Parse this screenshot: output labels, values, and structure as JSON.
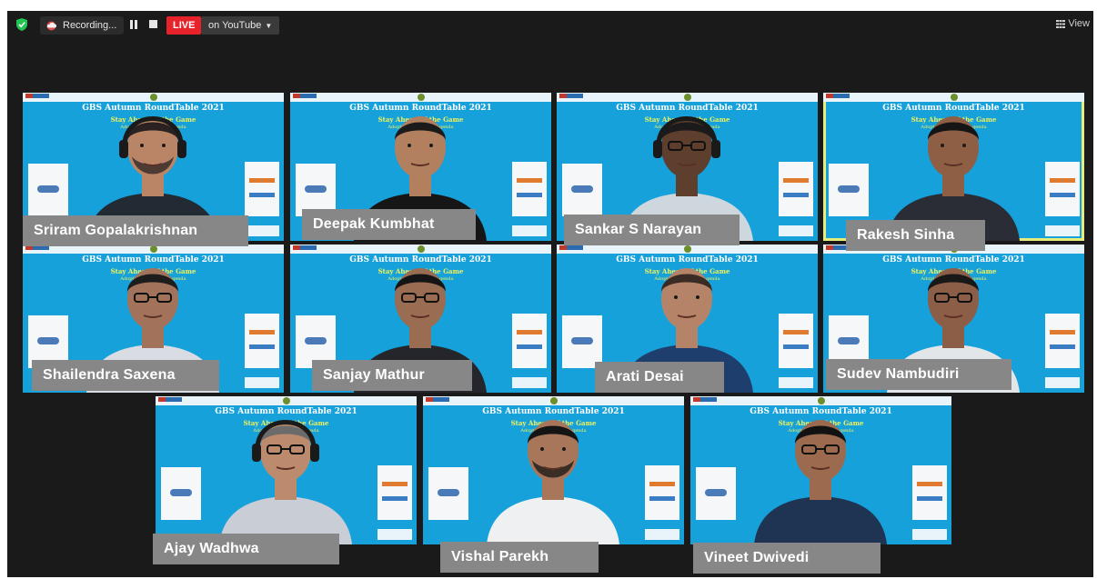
{
  "topbar": {
    "recording_label": "Recording...",
    "live_label": "LIVE",
    "live_destination": "on YouTube",
    "view_label": "View"
  },
  "slide": {
    "title": "GBS Autumn RoundTable 2021",
    "subtitle": "Stay Ahead of the Game",
    "tagline": "Adopting the Digital Agenda"
  },
  "participants": [
    {
      "name": "Sriram Gopalakrishnan",
      "shirt": "#222a33",
      "skin": "#b98566",
      "hair": "#2a2222",
      "headphones": true,
      "glasses": false,
      "beard": true
    },
    {
      "name": "Deepak Kumbhat",
      "shirt": "#161616",
      "skin": "#b3805f",
      "hair": "#1b1b1b",
      "headphones": false,
      "glasses": false,
      "beard": false
    },
    {
      "name": "Sankar S Narayan",
      "shirt": "#cfd7de",
      "skin": "#5e3f2e",
      "hair": "#1b1b1b",
      "headphones": true,
      "glasses": true,
      "beard": false
    },
    {
      "name": "Rakesh Sinha",
      "shirt": "#2a2d36",
      "skin": "#8f5f45",
      "hair": "#151515",
      "headphones": false,
      "glasses": false,
      "beard": false
    },
    {
      "name": "Shailendra Saxena",
      "shirt": "#d9dde3",
      "skin": "#a2735a",
      "hair": "#1d1d1d",
      "headphones": false,
      "glasses": true,
      "beard": false
    },
    {
      "name": "Sanjay Mathur",
      "shirt": "#24262b",
      "skin": "#9a6c52",
      "hair": "#151515",
      "headphones": false,
      "glasses": true,
      "beard": false
    },
    {
      "name": "Arati Desai",
      "shirt": "#1e3f6e",
      "skin": "#b58468",
      "hair": "#3a2c25",
      "headphones": false,
      "glasses": false,
      "beard": false
    },
    {
      "name": "Sudev Nambudiri",
      "shirt": "#e3e6e9",
      "skin": "#8c5e47",
      "hair": "#181818",
      "headphones": false,
      "glasses": true,
      "beard": false
    },
    {
      "name": "Ajay Wadhwa",
      "shirt": "#c9ced6",
      "skin": "#bc8a6c",
      "hair": "#6b6b6b",
      "headphones": true,
      "glasses": true,
      "beard": false
    },
    {
      "name": "Vishal Parekh",
      "shirt": "#eef0f2",
      "skin": "#a87659",
      "hair": "#151515",
      "headphones": false,
      "glasses": false,
      "beard": true
    },
    {
      "name": "Vineet Dwivedi",
      "shirt": "#1f3452",
      "skin": "#9b6a4f",
      "hair": "#121212",
      "headphones": false,
      "glasses": true,
      "beard": false
    }
  ],
  "active_speaker": "Rakesh Sinha",
  "colors": {
    "live": "#e8222b",
    "slide_bg": "#17a1da",
    "slide_accent": "#f1f15a",
    "active_border": "#e7ec7b",
    "nameplate": "#878787"
  }
}
